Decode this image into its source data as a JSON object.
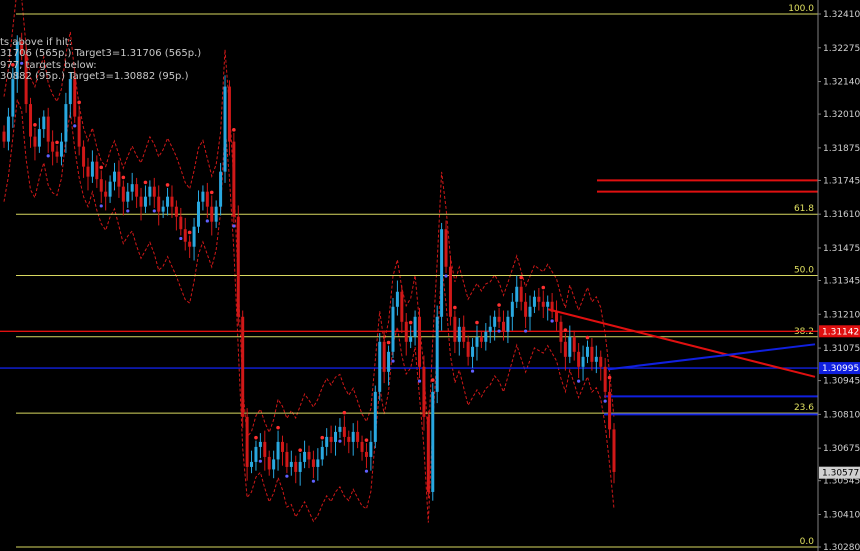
{
  "notes": [
    "ts above if hit:",
    "31706 (565p.) Target3=1.31706 (565p.)",
    "977, targets below:",
    "30882 (95p.) Target3=1.30882 (95p.)"
  ],
  "colors": {
    "background": "#000000",
    "bull_candle": "#29a8e0",
    "bear_candle": "#d01818",
    "fib_line": "#d8d860",
    "band": "#d01818",
    "blue_line": "#1020e0",
    "red_line": "#e01010",
    "axis_text": "#d0d0d0"
  },
  "chart_data": {
    "type": "candlestick",
    "y_range": [
      1.3025,
      1.3245
    ],
    "y_ticks": [
      "1.32410",
      "1.32275",
      "1.32140",
      "1.32010",
      "1.31875",
      "1.31745",
      "1.31610",
      "1.31475",
      "1.31345",
      "1.31210",
      "1.31075",
      "1.30945",
      "1.30810",
      "1.30675",
      "1.30545",
      "1.30410",
      "1.30280"
    ],
    "fib_levels": [
      {
        "label": "100.0",
        "price": 1.3241
      },
      {
        "label": "61.8",
        "price": 1.3161
      },
      {
        "label": "50.0",
        "price": 1.31365
      },
      {
        "label": "38.2",
        "price": 1.3112
      },
      {
        "label": "23.6",
        "price": 1.30815
      },
      {
        "label": "0.0",
        "price": 1.3028
      }
    ],
    "price_tags": [
      {
        "text": "1.31142",
        "price": 1.31142,
        "color": "#e01010"
      },
      {
        "text": "1.30995",
        "price": 1.30995,
        "color": "#1020e0"
      },
      {
        "text": "1.30577",
        "price": 1.30577,
        "color": "#d0d0d0"
      }
    ],
    "horizontal_lines": [
      {
        "price": 1.31142,
        "color": "#e01010",
        "full": true
      },
      {
        "price": 1.30995,
        "color": "#1020e0",
        "full": true
      },
      {
        "price": 1.31745,
        "color": "#e01010",
        "full": false
      },
      {
        "price": 1.317,
        "color": "#e01010",
        "full": false
      },
      {
        "price": 1.30882,
        "color": "#1020e0",
        "full": false
      },
      {
        "price": 1.3081,
        "color": "#1020e0",
        "full": false
      }
    ],
    "closes": [
      1.319,
      1.32,
      1.3215,
      1.323,
      1.3225,
      1.3205,
      1.3192,
      1.3188,
      1.3195,
      1.32,
      1.319,
      1.3186,
      1.3184,
      1.319,
      1.3205,
      1.3215,
      1.32,
      1.3188,
      1.318,
      1.3176,
      1.3182,
      1.3175,
      1.317,
      1.3168,
      1.3174,
      1.3178,
      1.3172,
      1.3166,
      1.317,
      1.3173,
      1.3168,
      1.3164,
      1.3168,
      1.3172,
      1.3168,
      1.3162,
      1.3164,
      1.3168,
      1.3164,
      1.316,
      1.3155,
      1.315,
      1.3148,
      1.3156,
      1.3166,
      1.317,
      1.3164,
      1.3158,
      1.3164,
      1.3178,
      1.3212,
      1.319,
      1.316,
      1.312,
      1.308,
      1.306,
      1.3062,
      1.3068,
      1.307,
      1.3064,
      1.3059,
      1.3063,
      1.307,
      1.3066,
      1.306,
      1.3062,
      1.3058,
      1.3062,
      1.3066,
      1.3063,
      1.306,
      1.3063,
      1.3068,
      1.3072,
      1.307,
      1.3074,
      1.3076,
      1.3072,
      1.307,
      1.3074,
      1.307,
      1.3066,
      1.3064,
      1.307,
      1.309,
      1.311,
      1.3098,
      1.3106,
      1.3124,
      1.313,
      1.3118,
      1.311,
      1.3112,
      1.312,
      1.31,
      1.308,
      1.305,
      1.309,
      1.312,
      1.3155,
      1.314,
      1.312,
      1.311,
      1.3116,
      1.311,
      1.3104,
      1.3108,
      1.3112,
      1.311,
      1.3114,
      1.3116,
      1.312,
      1.3118,
      1.3114,
      1.312,
      1.3126,
      1.3132,
      1.3126,
      1.312,
      1.3124,
      1.3128,
      1.3126,
      1.3124,
      1.3126,
      1.3122,
      1.3118,
      1.311,
      1.3104,
      1.3112,
      1.3106,
      1.31,
      1.3104,
      1.3108,
      1.3102,
      1.3104,
      1.31,
      1.309,
      1.3075,
      1.3058
    ]
  }
}
